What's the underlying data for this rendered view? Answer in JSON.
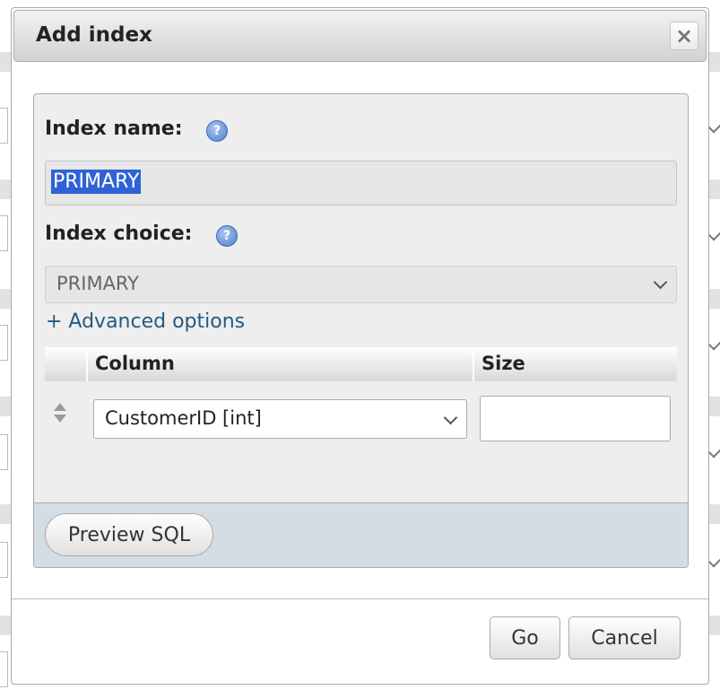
{
  "dialog": {
    "title": "Add index",
    "close_label": "×"
  },
  "form": {
    "index_name_label": "Index name:",
    "index_name_value": "PRIMARY",
    "index_choice_label": "Index choice:",
    "index_choice_value": "PRIMARY",
    "advanced_options_label": "+ Advanced options",
    "help_icon_glyph": "?"
  },
  "columns_table": {
    "headers": [
      "",
      "Column",
      "Size"
    ],
    "rows": [
      {
        "column": "CustomerID [int]",
        "size": ""
      }
    ]
  },
  "buttons": {
    "preview_sql": "Preview SQL",
    "go": "Go",
    "cancel": "Cancel"
  },
  "colors": {
    "link": "#235a81",
    "selection": "#2f62d6",
    "footer_bg": "#d5dde4"
  }
}
